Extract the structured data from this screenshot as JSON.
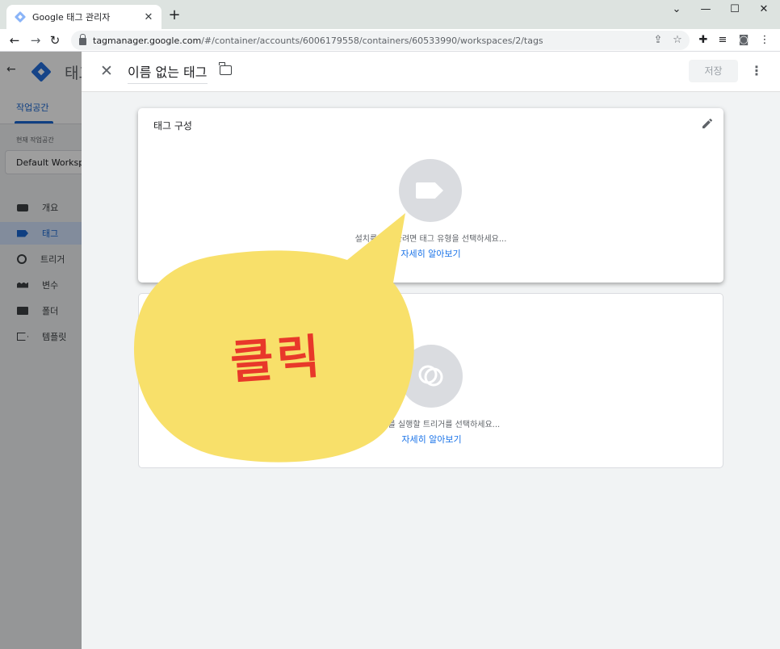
{
  "browser": {
    "tab_title": "Google 태그 관리자",
    "url_host": "tagmanager.google.com",
    "url_path": "/#/container/accounts/6006179558/containers/60533990/workspaces/2/tags"
  },
  "app": {
    "title": "태그",
    "workspace_tab": "작업공간",
    "current_workspace_label": "현재 작업공간",
    "workspace_name": "Default Workspace",
    "nav": [
      {
        "label": "개요",
        "icon": "overview-icon"
      },
      {
        "label": "태그",
        "icon": "tag-icon"
      },
      {
        "label": "트리거",
        "icon": "trigger-icon"
      },
      {
        "label": "변수",
        "icon": "variable-icon"
      },
      {
        "label": "폴더",
        "icon": "folder-icon"
      },
      {
        "label": "템플릿",
        "icon": "template-icon"
      }
    ]
  },
  "panel": {
    "tag_name": "이름 없는 태그",
    "save_label": "저장",
    "config_card": {
      "title": "태그 구성",
      "hint": "설치를 시작하려면 태그 유형을 선택하세요...",
      "learn_more": "자세히 알아보기"
    },
    "trigger_card": {
      "hint": "이 태그를 실행할 트리거를 선택하세요...",
      "learn_more": "자세히 알아보기"
    }
  },
  "annotation": {
    "text": "클릭",
    "bubble_color": "#f8e06a",
    "text_color": "#e8382a"
  },
  "colors": {
    "accent": "#1a73e8",
    "active_nav_bg": "#d2e3fc"
  }
}
